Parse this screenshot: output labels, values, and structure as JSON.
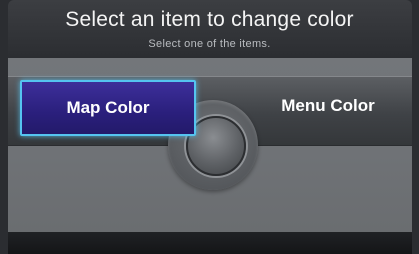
{
  "header": {
    "title": "Select an item to change color",
    "subtitle": "Select one of the items."
  },
  "options": {
    "map_color": "Map Color",
    "menu_color": "Menu Color"
  },
  "colors": {
    "selected_fill": "#2a1f7c",
    "selected_border": "#55c4f0",
    "panel": "#6f7276"
  },
  "icons": {
    "selector_knob": "interface-dial-icon"
  },
  "state": {
    "selected": "Map Color"
  }
}
